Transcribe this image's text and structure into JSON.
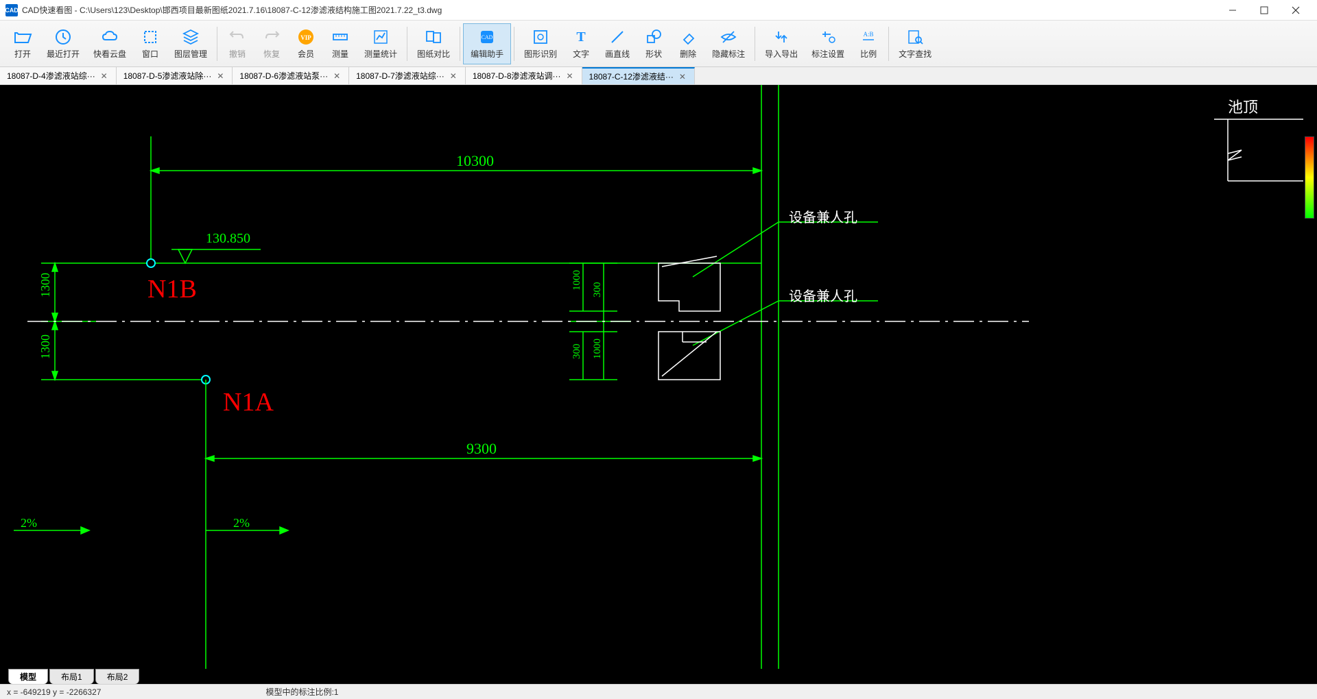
{
  "app": {
    "name": "CAD快速看图",
    "path": "C:\\Users\\123\\Desktop\\邯西项目最新图纸2021.7.16\\18087-C-12渗滤液结构施工图2021.7.22_t3.dwg"
  },
  "toolbar": {
    "open": "打开",
    "recent": "最近打开",
    "cloud": "快看云盘",
    "window": "窗口",
    "layers": "图层管理",
    "undo": "撤销",
    "redo": "恢复",
    "vip": "会员",
    "measure": "测量",
    "mstat": "测量统计",
    "compare": "图纸对比",
    "helper": "编辑助手",
    "recognize": "图形识别",
    "text": "文字",
    "line": "画直线",
    "shape": "形状",
    "delete": "删除",
    "hide": "隐藏标注",
    "io": "导入导出",
    "annoset": "标注设置",
    "ratio": "比例",
    "findtext": "文字查找"
  },
  "tabs": [
    {
      "label": "18087-D-4渗滤液站综···",
      "active": false
    },
    {
      "label": "18087-D-5渗滤液站除···",
      "active": false
    },
    {
      "label": "18087-D-6渗滤液站泵···",
      "active": false
    },
    {
      "label": "18087-D-7渗滤液站综···",
      "active": false
    },
    {
      "label": "18087-D-8渗滤液站调···",
      "active": false
    },
    {
      "label": "18087-C-12渗滤液结···",
      "active": true
    }
  ],
  "drawing": {
    "dim_top": "10300",
    "dim_bottom": "9300",
    "elev": "130.850",
    "dim_left1": "1300",
    "dim_left2": "1300",
    "label_n1b": "N1B",
    "label_n1a": "N1A",
    "note1": "设备兼人孔",
    "note2": "设备兼人孔",
    "dim_v1": "1000",
    "dim_v2": "300",
    "dim_v3": "300",
    "dim_v4": "1000",
    "slope1": "2%",
    "slope2": "2%",
    "corner_label": "池顶"
  },
  "bottom_tabs": {
    "model": "模型",
    "layout1": "布局1",
    "layout2": "布局2"
  },
  "status": {
    "coords": "x = -649219  y = -2266327",
    "scale": "模型中的标注比例:1"
  }
}
